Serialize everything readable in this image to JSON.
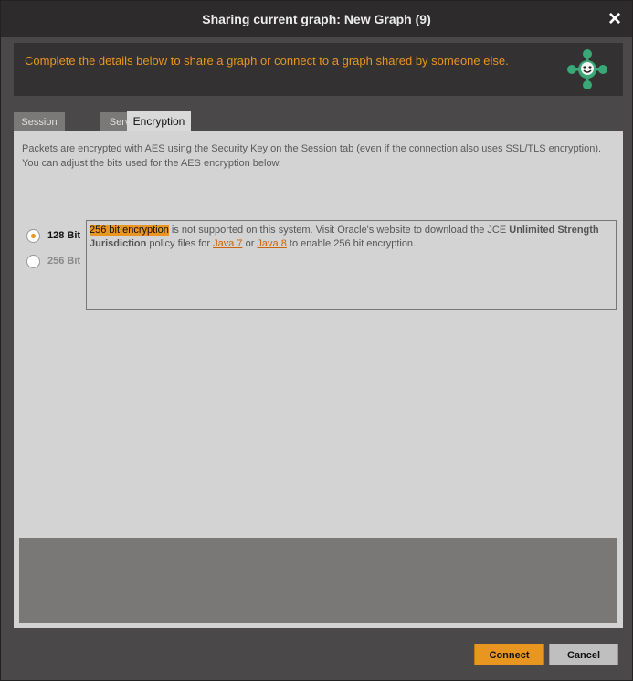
{
  "window": {
    "title": "Sharing current graph: New Graph (9)",
    "close_icon": "×"
  },
  "banner": {
    "text": "Complete the details below to share a graph or connect to a graph shared by someone else.",
    "logo_icon": "graph-share-logo-icon"
  },
  "tabs": [
    {
      "label": "Session",
      "active": false
    },
    {
      "label": "Server",
      "active": false
    },
    {
      "label": "Encryption",
      "active": true
    }
  ],
  "encryption": {
    "description_line1": "Packets are encrypted with AES using the Security Key on the Session tab (even if the connection also uses SSL/TLS encryption).",
    "description_line2": "You can adjust the bits used for the AES encryption below.",
    "options": [
      {
        "label": "128 Bit",
        "selected": true,
        "enabled": true
      },
      {
        "label": "256 Bit",
        "selected": false,
        "enabled": false
      }
    ],
    "notice": {
      "highlight": "256 bit encryption",
      "text1": " is not supported on this system. Visit Oracle's website to download the JCE ",
      "bold": "Unlimited Strength Jurisdiction",
      "text2": " policy files for ",
      "link1": "Java 7",
      "text3": " or ",
      "link2": "Java 8",
      "text4": " to enable 256 bit encryption."
    }
  },
  "buttons": {
    "connect": "Connect",
    "cancel": "Cancel"
  },
  "colors": {
    "accent": "#e8961f",
    "titlebar": "#2d2b2b",
    "panel": "#d3d3d3"
  }
}
